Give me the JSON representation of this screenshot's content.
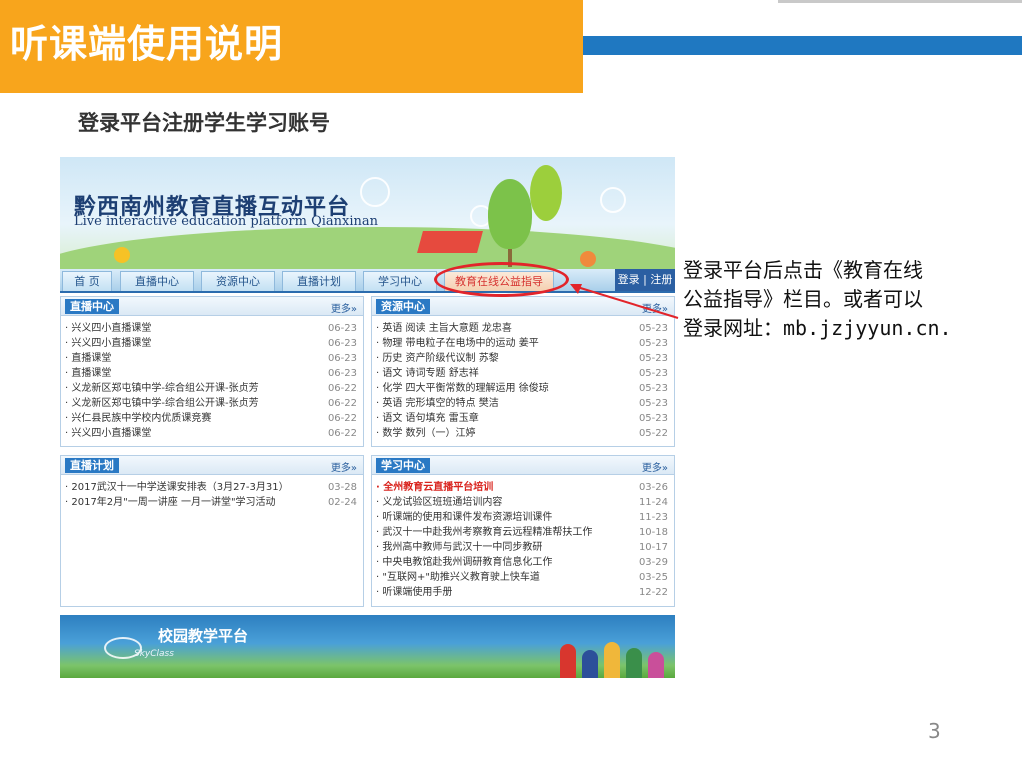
{
  "slide": {
    "title": "听课端使用说明",
    "subtitle": "登录平台注册学生学习账号",
    "page_number": "3",
    "instructions": {
      "line1": "登录平台后点击《教育在线",
      "line2": "公益指导》栏目。或者可以",
      "line3_prefix": "登录网址：",
      "line3_url": "mb.jzjyyun.cn."
    },
    "colors": {
      "orange": "#f8a51c",
      "blue_band": "#1f78c1",
      "highlight_red": "#e2242a"
    }
  },
  "site": {
    "header": {
      "title_cn": "黔西南州教育直播互动平台",
      "title_en": "Live interactive education platform Qianxinan"
    },
    "nav": {
      "tabs": [
        "首 页",
        "直播中心",
        "资源中心",
        "直播计划",
        "学习中心",
        "教育在线公益指导"
      ],
      "login": "登录 | 注册"
    },
    "panels": {
      "live_center": {
        "title": "直播中心",
        "more": "更多»",
        "items": [
          {
            "t": "· 兴义四小直播课堂",
            "d": "06-23"
          },
          {
            "t": "· 兴义四小直播课堂",
            "d": "06-23"
          },
          {
            "t": "· 直播课堂",
            "d": "06-23"
          },
          {
            "t": "· 直播课堂",
            "d": "06-23"
          },
          {
            "t": "· 义龙新区郑屯镇中学-综合组公开课-张贞芳",
            "d": "06-22"
          },
          {
            "t": "· 义龙新区郑屯镇中学-综合组公开课-张贞芳",
            "d": "06-22"
          },
          {
            "t": "· 兴仁县民族中学校内优质课竞赛",
            "d": "06-22"
          },
          {
            "t": "· 兴义四小直播课堂",
            "d": "06-22"
          }
        ]
      },
      "resource_center": {
        "title": "资源中心",
        "more": "更多»",
        "items": [
          {
            "t": "· 英语 阅读 主旨大意题 龙忠喜",
            "d": "05-23"
          },
          {
            "t": "· 物理 带电粒子在电场中的运动 姜平",
            "d": "05-23"
          },
          {
            "t": "· 历史 资产阶级代议制 苏黎",
            "d": "05-23"
          },
          {
            "t": "· 语文 诗词专题 舒志祥",
            "d": "05-23"
          },
          {
            "t": "· 化学 四大平衡常数的理解运用 徐俊琼",
            "d": "05-23"
          },
          {
            "t": "· 英语 完形填空的特点 樊洁",
            "d": "05-23"
          },
          {
            "t": "· 语文 语句填充 雷玉章",
            "d": "05-23"
          },
          {
            "t": "· 数学 数列（一）江婷",
            "d": "05-22"
          }
        ]
      },
      "live_plan": {
        "title": "直播计划",
        "more": "更多»",
        "items": [
          {
            "t": "· 2017武汉十一中学送课安排表（3月27-3月31）",
            "d": "03-28"
          },
          {
            "t": "· 2017年2月\"一周一讲座 一月一讲堂\"学习活动",
            "d": "02-24"
          }
        ]
      },
      "study_center": {
        "title": "学习中心",
        "more": "更多»",
        "items": [
          {
            "t": "· 全州教育云直播平台培训",
            "d": "03-26",
            "red": true
          },
          {
            "t": "· 义龙试验区班班通培训内容",
            "d": "11-24"
          },
          {
            "t": "· 听课端的使用和课件发布资源培训课件",
            "d": "11-23"
          },
          {
            "t": "· 武汉十一中赴我州考察教育云远程精准帮扶工作",
            "d": "10-18"
          },
          {
            "t": "· 我州高中教师与武汉十一中同步教研",
            "d": "10-17"
          },
          {
            "t": "· 中央电教馆赴我州调研教育信息化工作",
            "d": "03-29"
          },
          {
            "t": "· \"互联网+\"助推兴义教育驶上快车道",
            "d": "03-25"
          },
          {
            "t": "· 听课端使用手册",
            "d": "12-22"
          }
        ]
      }
    },
    "footer_banner": {
      "title": "校园教学平台",
      "logo_text": "SkyClass"
    }
  }
}
